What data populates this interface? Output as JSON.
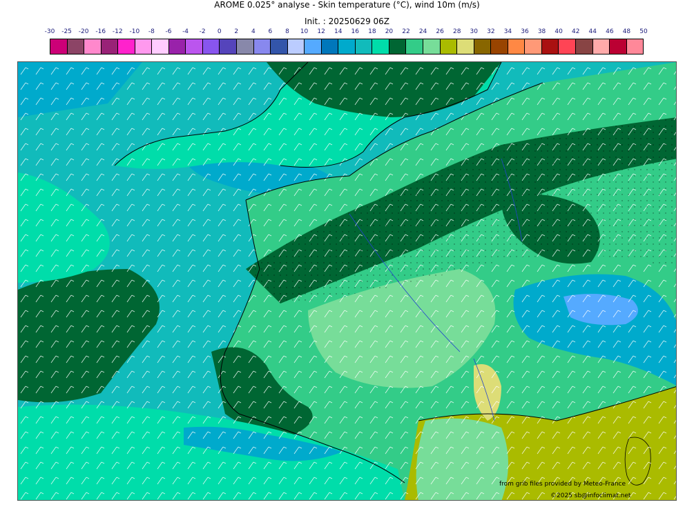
{
  "title_line1": "AROME 0.025° analyse - Skin temperature (°C), wind 10m (m/s)",
  "title_line2": "Init. : 20250629 06Z",
  "legend": {
    "tick_labels": [
      "-30",
      "-25",
      "-20",
      "-16",
      "-12",
      "-10",
      "-8",
      "-6",
      "-4",
      "-2",
      "0",
      "2",
      "4",
      "6",
      "8",
      "10",
      "12",
      "14",
      "16",
      "18",
      "20",
      "22",
      "24",
      "26",
      "28",
      "30",
      "32",
      "34",
      "36",
      "38",
      "40",
      "42",
      "44",
      "46",
      "48",
      "50"
    ],
    "colors": [
      "#cc0077",
      "#8c4466",
      "#ff88cc",
      "#992277",
      "#ff22cc",
      "#ff99ee",
      "#ffccff",
      "#9922aa",
      "#bb55ee",
      "#8855ee",
      "#5544bb",
      "#8888aa",
      "#8888ee",
      "#3355aa",
      "#bbccff",
      "#55aaff",
      "#0077bb",
      "#00aacc",
      "#11bbbb",
      "#00ddaa",
      "#006633",
      "#33cc88",
      "#77dd99",
      "#aabb00",
      "#dddd77",
      "#886600",
      "#994400",
      "#ff8844",
      "#ff9977",
      "#aa1111",
      "#ff4455",
      "#884444",
      "#ffaaaa",
      "#bb0033",
      "#ff8899"
    ]
  },
  "map": {
    "region": "France and surroundings",
    "land_base_color": "#33cc88",
    "sea_color": "#11bbbb",
    "wind_barbs_color": "#ffffff"
  },
  "credits": {
    "source": "from grib files provided by Meteo-France",
    "copyright": "©2025 sb@infoclimat.net"
  }
}
